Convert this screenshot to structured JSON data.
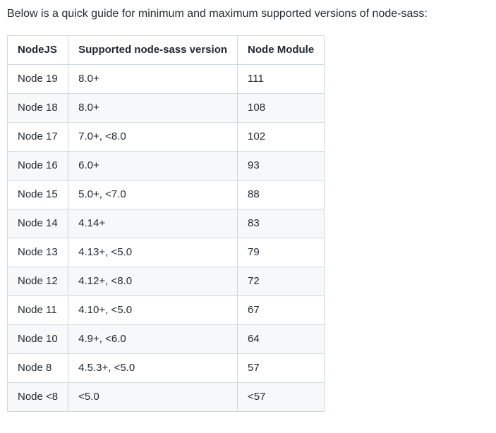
{
  "intro": "Below is a quick guide for minimum and maximum supported versions of node-sass:",
  "table": {
    "headers": [
      "NodeJS",
      "Supported node-sass version",
      "Node Module"
    ],
    "rows": [
      [
        "Node 19",
        "8.0+",
        "111"
      ],
      [
        "Node 18",
        "8.0+",
        "108"
      ],
      [
        "Node 17",
        "7.0+, <8.0",
        "102"
      ],
      [
        "Node 16",
        "6.0+",
        "93"
      ],
      [
        "Node 15",
        "5.0+, <7.0",
        "88"
      ],
      [
        "Node 14",
        "4.14+",
        "83"
      ],
      [
        "Node 13",
        "4.13+, <5.0",
        "79"
      ],
      [
        "Node 12",
        "4.12+, <8.0",
        "72"
      ],
      [
        "Node 11",
        "4.10+, <5.0",
        "67"
      ],
      [
        "Node 10",
        "4.9+, <6.0",
        "64"
      ],
      [
        "Node 8",
        "4.5.3+, <5.0",
        "57"
      ],
      [
        "Node <8",
        "<5.0",
        "<57"
      ]
    ]
  }
}
